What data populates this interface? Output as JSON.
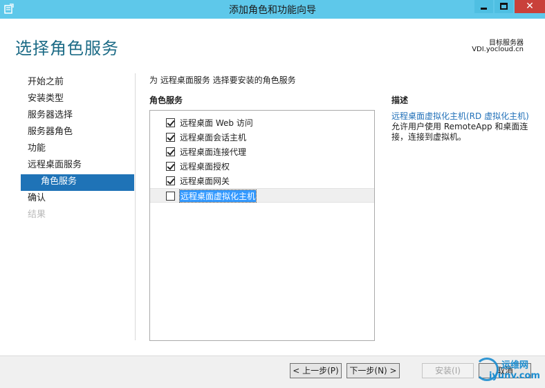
{
  "window": {
    "title": "添加角色和功能向导",
    "close_glyph": "✕"
  },
  "header": {
    "page_title": "选择角色服务",
    "dest_server_label": "目标服务器",
    "dest_server_value": "VDI.yocloud.cn"
  },
  "sidebar": {
    "items": [
      {
        "label": "开始之前",
        "state": "normal"
      },
      {
        "label": "安装类型",
        "state": "normal"
      },
      {
        "label": "服务器选择",
        "state": "normal"
      },
      {
        "label": "服务器角色",
        "state": "normal"
      },
      {
        "label": "功能",
        "state": "normal"
      },
      {
        "label": "远程桌面服务",
        "state": "normal"
      },
      {
        "label": "角色服务",
        "state": "active"
      },
      {
        "label": "确认",
        "state": "normal"
      },
      {
        "label": "结果",
        "state": "disabled"
      }
    ]
  },
  "main": {
    "instruction": "为 远程桌面服务 选择要安装的角色服务",
    "roles_heading": "角色服务",
    "desc_heading": "描述",
    "roles": [
      {
        "label": "远程桌面 Web 访问",
        "checked": true,
        "selected": false
      },
      {
        "label": "远程桌面会话主机",
        "checked": true,
        "selected": false
      },
      {
        "label": "远程桌面连接代理",
        "checked": true,
        "selected": false
      },
      {
        "label": "远程桌面授权",
        "checked": true,
        "selected": false
      },
      {
        "label": "远程桌面网关",
        "checked": true,
        "selected": false
      },
      {
        "label": "远程桌面虚拟化主机",
        "checked": false,
        "selected": true
      }
    ],
    "description_link": "远程桌面虚拟化主机(RD 虚拟化主机)",
    "description_text": "允许用户使用 RemoteApp 和桌面连接，连接到虚拟机。"
  },
  "footer": {
    "prev_label": "< 上一步(P)",
    "next_label": "下一步(N) >",
    "install_label": "安装(I)",
    "cancel_label": "取消"
  },
  "watermark": {
    "cn": "运维网",
    "en": "iyunv.com"
  },
  "colors": {
    "titlebar": "#5ec8ea",
    "accent": "#1f73b7",
    "title_text": "#1c6b86"
  }
}
